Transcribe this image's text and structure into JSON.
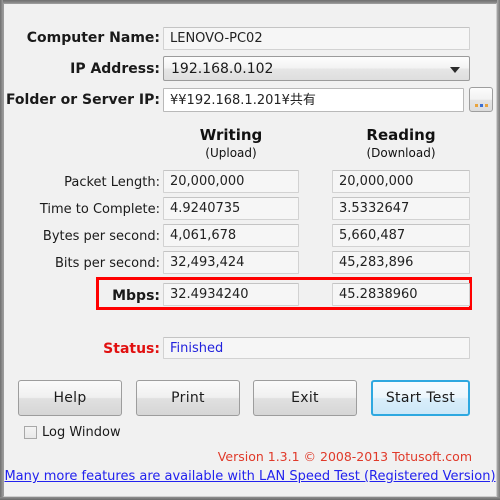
{
  "window": {
    "bg_color": "#f1f1f1",
    "border_color": "#8e8e8e"
  },
  "form": {
    "computer_name_label": "Computer Name:",
    "computer_name_value": "LENOVO-PC02",
    "ip_address_label": "IP Address:",
    "ip_address_value": "192.168.0.102",
    "folder_label": "Folder or Server IP:",
    "folder_value": "¥¥192.168.1.201¥共有",
    "browse_button_label": "..."
  },
  "columns": {
    "writing_title": "Writing",
    "writing_sub": "(Upload)",
    "reading_title": "Reading",
    "reading_sub": "(Download)"
  },
  "metrics": [
    {
      "label": "Packet Length:",
      "writing": "20,000,000",
      "reading": "20,000,000",
      "highlight": false
    },
    {
      "label": "Time to Complete:",
      "writing": "4.9240735",
      "reading": "3.5332647",
      "highlight": false
    },
    {
      "label": "Bytes per second:",
      "writing": "4,061,678",
      "reading": "5,660,487",
      "highlight": false
    },
    {
      "label": "Bits per second:",
      "writing": "32,493,424",
      "reading": "45,283,896",
      "highlight": false
    },
    {
      "label": "Mbps:",
      "writing": "32.4934240",
      "reading": "45.2838960",
      "highlight": true
    }
  ],
  "status": {
    "label": "Status:",
    "value": "Finished",
    "label_color": "#e11010",
    "value_color": "#2222dd"
  },
  "buttons": {
    "help": "Help",
    "print": "Print",
    "exit": "Exit",
    "start_test": "Start Test"
  },
  "log_window": {
    "label": "Log Window",
    "checked": false
  },
  "footer": {
    "version": "Version 1.3.1 © 2008-2013 Totusoft.com",
    "link": "Many more features are available with LAN Speed Test (Registered Version)",
    "version_color": "#e03a2a",
    "link_color": "#2222ee"
  },
  "highlight": {
    "mbps_box_color": "#ff0000"
  }
}
